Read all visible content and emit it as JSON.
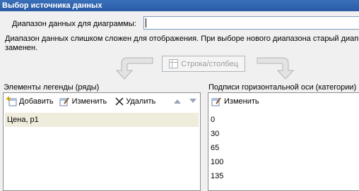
{
  "window": {
    "title": "Выбор источника данных"
  },
  "range": {
    "label": "Диапазон данных для диаграммы:",
    "value": ""
  },
  "info_text": "Диапазон данных слишком сложен для отображения. При выборе нового диапазона старый диапа\nзаменен.",
  "switch_button": {
    "label": "Строка/столбец"
  },
  "legend": {
    "title": "Элементы легенды (ряды)",
    "add_label": "Добавить",
    "edit_label": "Изменить",
    "delete_label": "Удалить",
    "items": [
      "Цена, р1"
    ]
  },
  "axis": {
    "title": "Подписи горизонтальной оси (категории)",
    "edit_label": "Изменить",
    "items": [
      "0",
      "30",
      "65",
      "100",
      "135"
    ]
  },
  "colors": {
    "titlebar": "#2a5ba6",
    "selected_row": "#efecdc",
    "disabled_text": "#9b9b9b"
  }
}
